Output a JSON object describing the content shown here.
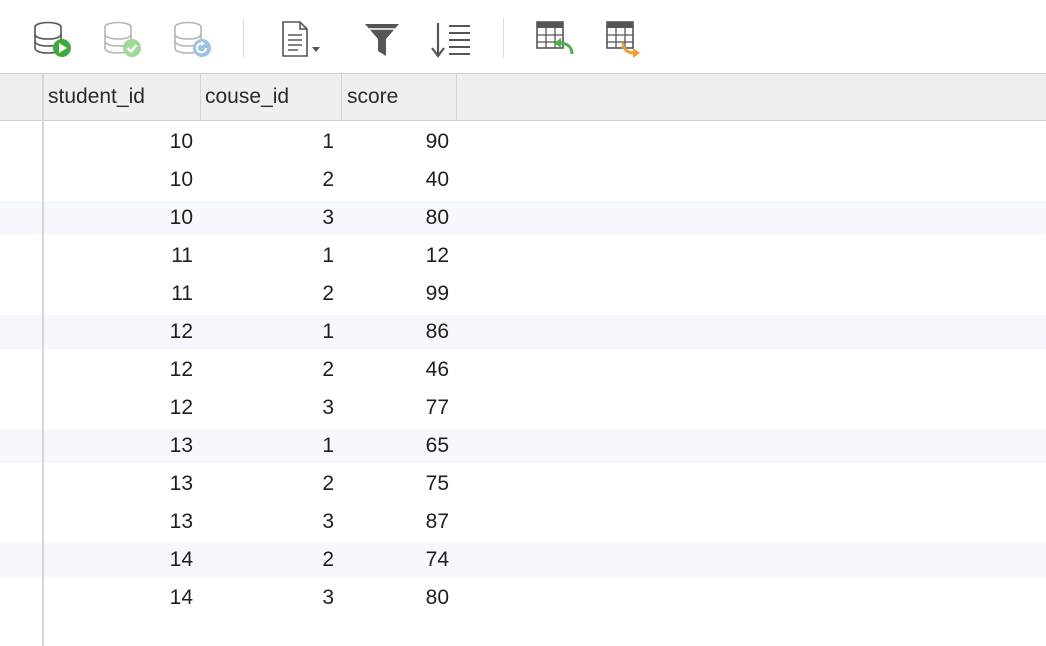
{
  "toolbar": {
    "icons": [
      "run-database-icon",
      "commit-database-icon",
      "refresh-database-icon",
      "document-dropdown-icon",
      "filter-icon",
      "sort-icon",
      "import-table-icon",
      "export-table-icon"
    ]
  },
  "table": {
    "columns": [
      "student_id",
      "couse_id",
      "score"
    ],
    "rows": [
      {
        "student_id": "10",
        "couse_id": "1",
        "score": "90"
      },
      {
        "student_id": "10",
        "couse_id": "2",
        "score": "40"
      },
      {
        "student_id": "10",
        "couse_id": "3",
        "score": "80"
      },
      {
        "student_id": "11",
        "couse_id": "1",
        "score": "12"
      },
      {
        "student_id": "11",
        "couse_id": "2",
        "score": "99"
      },
      {
        "student_id": "12",
        "couse_id": "1",
        "score": "86"
      },
      {
        "student_id": "12",
        "couse_id": "2",
        "score": "46"
      },
      {
        "student_id": "12",
        "couse_id": "3",
        "score": "77"
      },
      {
        "student_id": "13",
        "couse_id": "1",
        "score": "65"
      },
      {
        "student_id": "13",
        "couse_id": "2",
        "score": "75"
      },
      {
        "student_id": "13",
        "couse_id": "3",
        "score": "87"
      },
      {
        "student_id": "14",
        "couse_id": "2",
        "score": "74"
      },
      {
        "student_id": "14",
        "couse_id": "3",
        "score": "80"
      }
    ]
  },
  "colors": {
    "run_green": "#3daa3d",
    "commit_green": "#9fd99a",
    "refresh_blue": "#9cc3e6",
    "export_orange": "#f0a030",
    "import_green": "#4caf50",
    "header_bg": "#efefef",
    "alt_row_bg": "#f5f8fc"
  }
}
